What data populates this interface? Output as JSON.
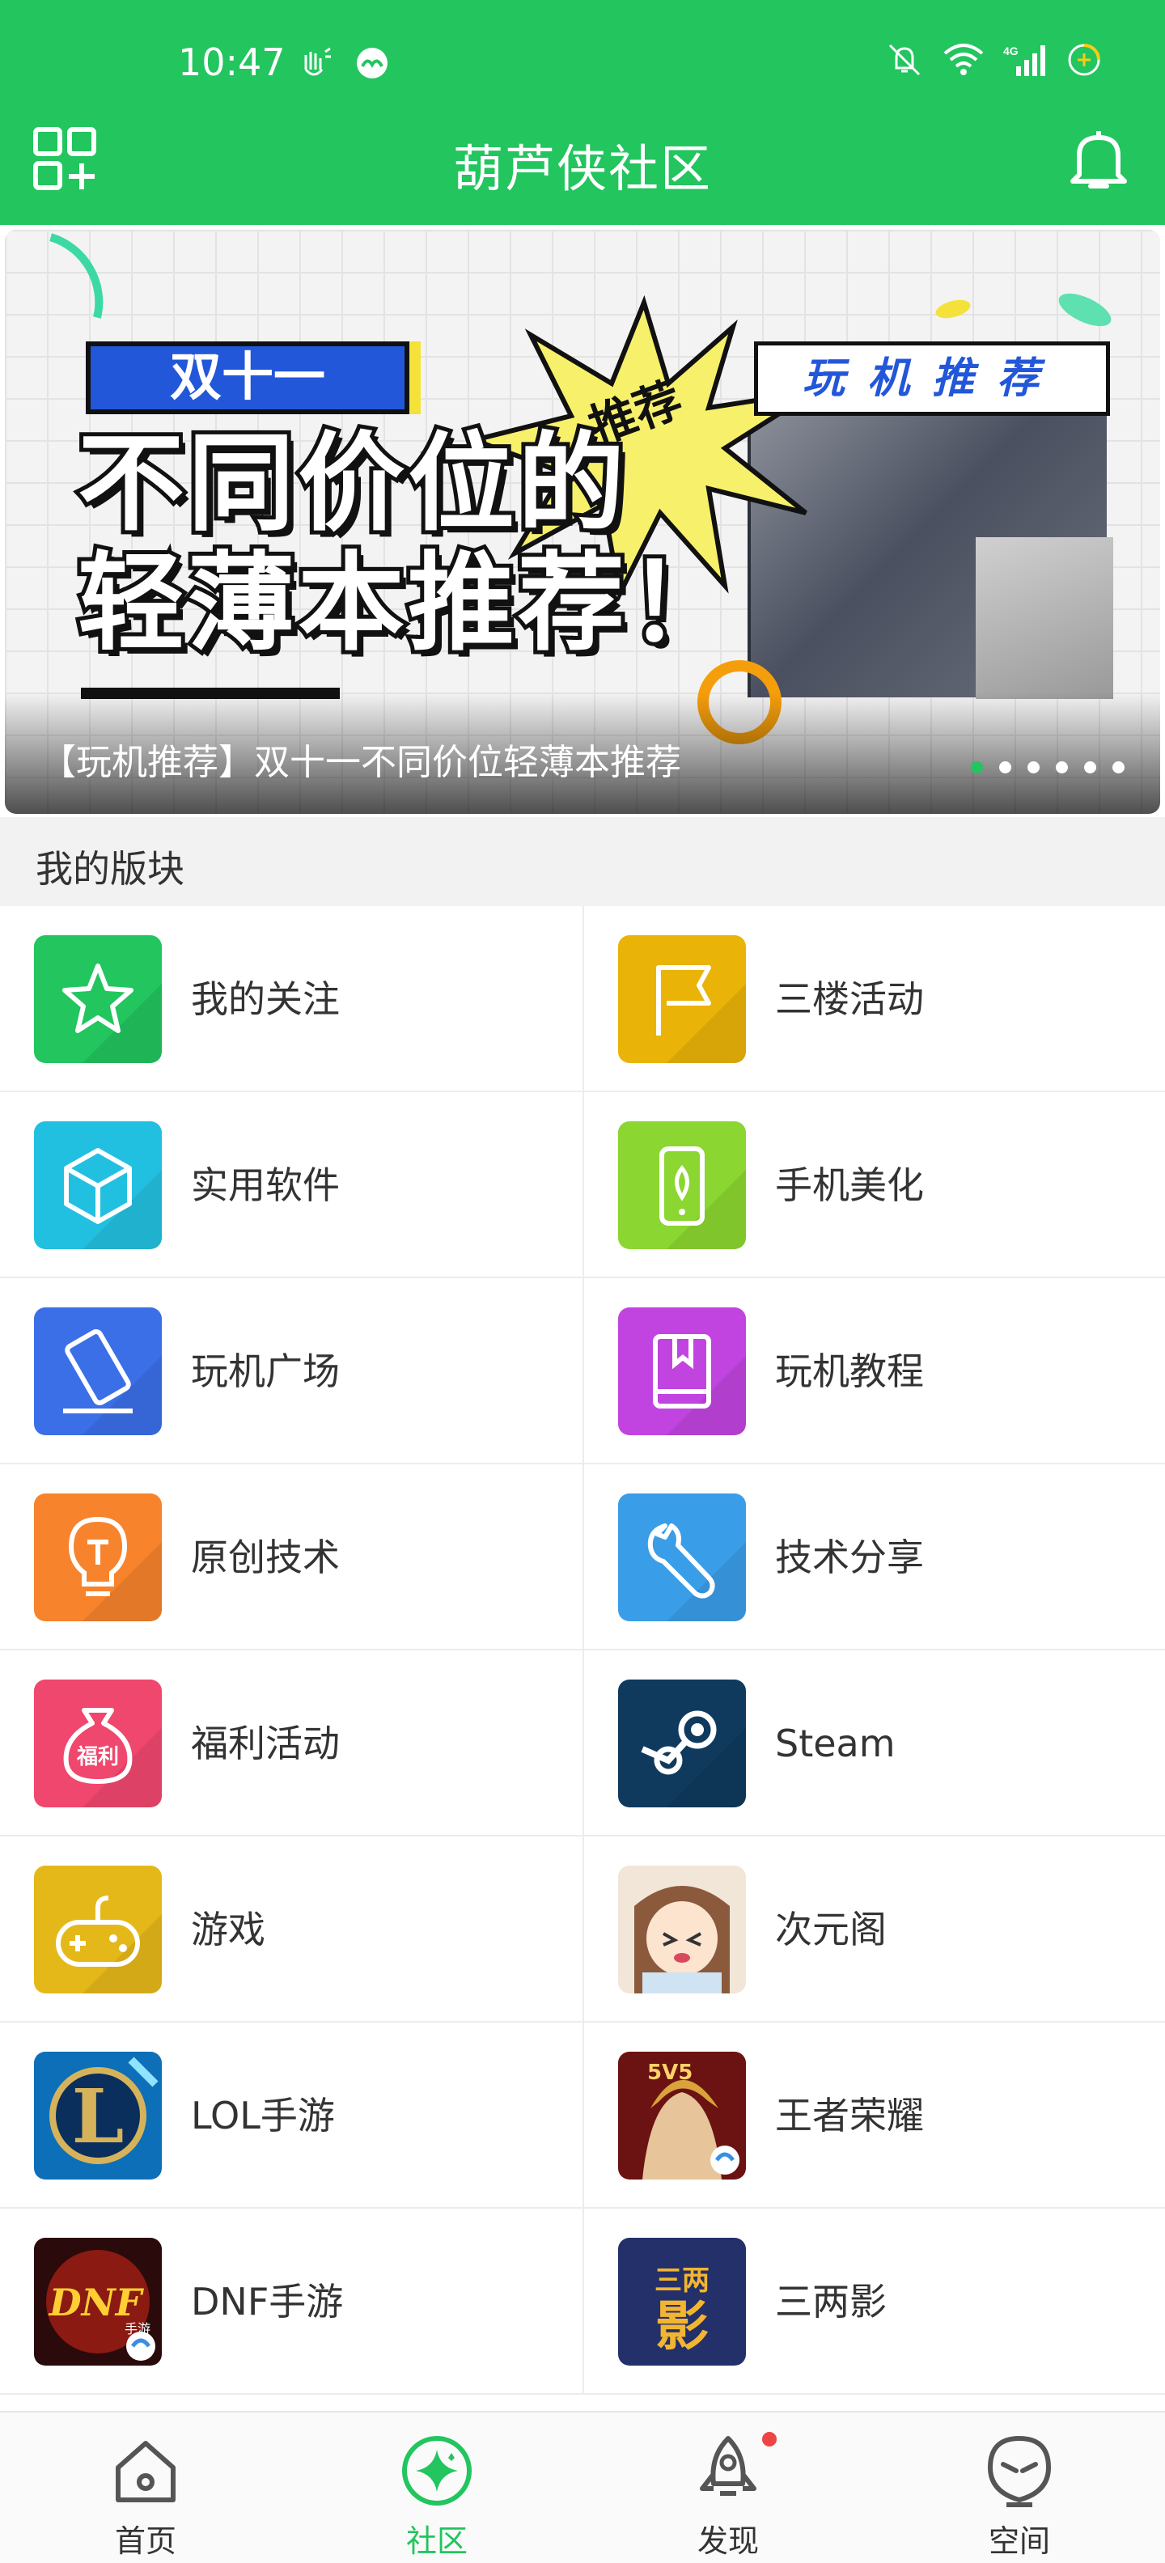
{
  "status_bar": {
    "time": "10:47",
    "left_icons": [
      "vibrate-hand-icon",
      "app-notify-icon"
    ],
    "right_icons": [
      "mute-icon",
      "wifi-icon",
      "4g-signal-icon",
      "battery-charging-icon"
    ],
    "network_label": "4G"
  },
  "header": {
    "title": "葫芦侠社区",
    "left_icon": "qr-add-icon",
    "right_icon": "bell-icon",
    "color": "#22c55e"
  },
  "banner": {
    "tag": "双十一",
    "headline_line1": "不同价位的",
    "headline_line2": "轻薄本推荐！",
    "star_text": "推荐",
    "corner_label": "玩机推荐",
    "caption": "【玩机推荐】双十一不同价位轻薄本推荐",
    "dot_count": 6,
    "active_dot": 0
  },
  "section": {
    "title": "我的版块"
  },
  "boards": [
    {
      "label": "我的关注",
      "icon": "star-icon",
      "color": "#22c55e"
    },
    {
      "label": "三楼活动",
      "icon": "flag-icon",
      "color": "#eab308"
    },
    {
      "label": "实用软件",
      "icon": "cube-icon",
      "color": "#22c0e0"
    },
    {
      "label": "手机美化",
      "icon": "phone-leaf-icon",
      "color": "#8bd630"
    },
    {
      "label": "玩机广场",
      "icon": "tilted-phone-icon",
      "color": "#3b6fe8"
    },
    {
      "label": "玩机教程",
      "icon": "book-icon",
      "color": "#c244e0"
    },
    {
      "label": "原创技术",
      "icon": "bulb-icon",
      "color": "#f7832c"
    },
    {
      "label": "技术分享",
      "icon": "wrench-icon",
      "color": "#3a9de8"
    },
    {
      "label": "福利活动",
      "icon": "money-bag-icon",
      "color": "#f0476e"
    },
    {
      "label": "Steam",
      "icon": "steam-logo-icon",
      "color": "#0f3a5e"
    },
    {
      "label": "游戏",
      "icon": "gamepad-icon",
      "color": "#e5b81a"
    },
    {
      "label": "次元阁",
      "icon": "anime-avatar-icon",
      "color": "#e9d9c8"
    },
    {
      "label": "LOL手游",
      "icon": "lol-logo-icon",
      "color": "#1a6fb8"
    },
    {
      "label": "王者荣耀",
      "icon": "honor-of-kings-icon",
      "color": "#7a1a1a"
    },
    {
      "label": "DNF手游",
      "icon": "dnf-logo-icon",
      "color": "#5a1010"
    },
    {
      "label": "三两影",
      "icon": "sanliangying-icon",
      "color": "#2a3470"
    }
  ],
  "board_icon_texts": {
    "welfare": "福利",
    "dnf": "DNF",
    "dnf_sub": "手游",
    "sanliang": "三两",
    "sanliang_big": "影",
    "lol": "L",
    "wzry": "5V5"
  },
  "bottom_nav": [
    {
      "label": "首页",
      "icon": "home-icon",
      "active": false
    },
    {
      "label": "社区",
      "icon": "community-sparkle-icon",
      "active": true
    },
    {
      "label": "发现",
      "icon": "rocket-icon",
      "active": false,
      "badge": true
    },
    {
      "label": "空间",
      "icon": "alien-face-icon",
      "active": false
    }
  ]
}
